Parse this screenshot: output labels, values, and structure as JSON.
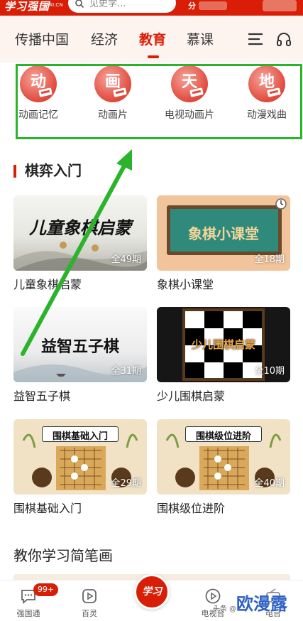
{
  "header": {
    "logo_text": "学习强国",
    "logo_sub": "XUEXI.CN",
    "search_placeholder": "见史学...",
    "score_label": "分"
  },
  "tabs": [
    {
      "label": "传播中国",
      "active": false
    },
    {
      "label": "经济",
      "active": false
    },
    {
      "label": "教育",
      "active": true
    },
    {
      "label": "慕课",
      "active": false
    }
  ],
  "categories": [
    {
      "glyph": "动",
      "label": "动画记忆"
    },
    {
      "glyph": "画",
      "label": "动画片"
    },
    {
      "glyph": "天",
      "label": "电视动画片"
    },
    {
      "glyph": "地",
      "label": "动漫戏曲"
    }
  ],
  "section1": {
    "title": "棋弈入门"
  },
  "courses": [
    {
      "name": "儿童象棋启蒙",
      "episodes": "全49期",
      "thumb_title": "儿童象棋启蒙"
    },
    {
      "name": "象棋小课堂",
      "episodes": "全18期",
      "thumb_title": "象棋小课堂"
    },
    {
      "name": "益智五子棋",
      "episodes": "全31期",
      "thumb_title": "益智五子棋"
    },
    {
      "name": "少儿围棋启蒙",
      "episodes": "全10期",
      "thumb_title": "少儿围棋启蒙"
    },
    {
      "name": "围棋基础入门",
      "episodes": "全29期",
      "thumb_title": "围棋基础入门"
    },
    {
      "name": "围棋级位进阶",
      "episodes": "全40期",
      "thumb_title": "围棋级位进阶"
    }
  ],
  "section2": {
    "title": "教你学习简笔画"
  },
  "bottom_nav": {
    "items": [
      {
        "label": "强国通",
        "icon": "chat-icon"
      },
      {
        "label": "百灵",
        "icon": "play-square-icon"
      },
      {
        "label": "电视台",
        "icon": "play-circle-icon"
      },
      {
        "label": "电台",
        "icon": "radio-icon"
      }
    ],
    "badge": "99+",
    "center_logo": "学习"
  },
  "watermark": {
    "small": "头条 @",
    "big": "欧漫露"
  },
  "colors": {
    "brand_red": "#d81e06",
    "highlight_green": "#2bb32b",
    "watermark_blue": "#2f62c4"
  }
}
